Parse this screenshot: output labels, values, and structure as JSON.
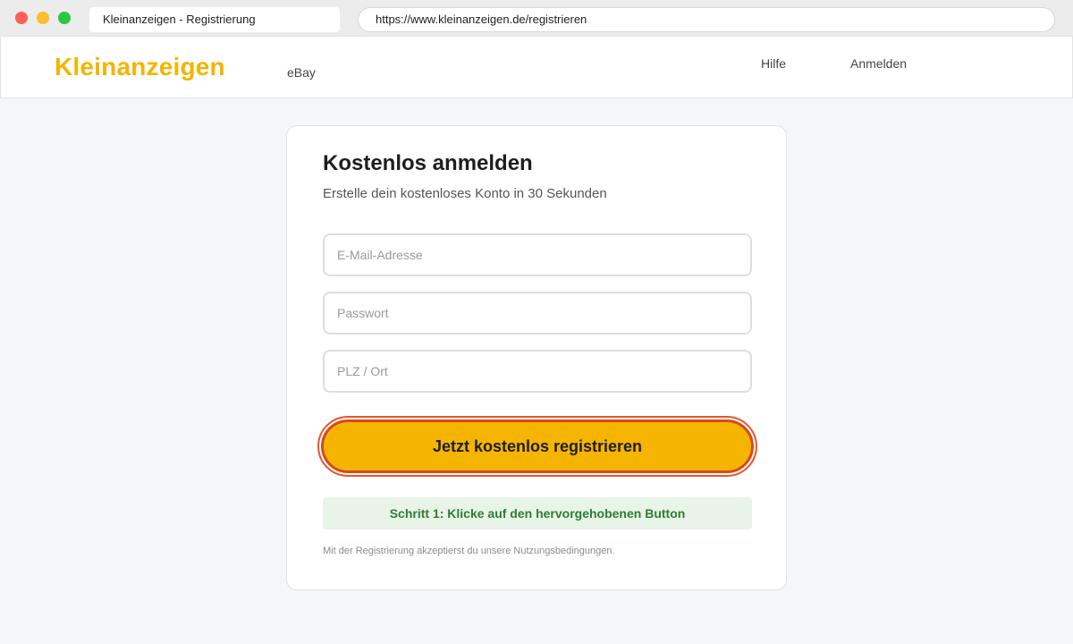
{
  "browser": {
    "tab_title": "Kleinanzeigen - Registrierung",
    "url": "https://www.kleinanzeigen.de/registrieren"
  },
  "header": {
    "logo": "Kleinanzeigen",
    "nav": {
      "ebay": "eBay",
      "hilfe": "Hilfe",
      "anmelden": "Anmelden"
    }
  },
  "form": {
    "title": "Kostenlos anmelden",
    "subtitle": "Erstelle dein kostenloses Konto in 30 Sekunden",
    "email": {
      "placeholder": "E-Mail-Adresse",
      "value": ""
    },
    "password": {
      "placeholder": "Passwort",
      "value": ""
    },
    "location": {
      "placeholder": "PLZ / Ort",
      "value": ""
    },
    "submit_label": "Jetzt kostenlos registrieren",
    "hint": "Schritt 1: Klicke auf den hervorgehobenen Button",
    "terms": "Mit der Registrierung akzeptierst du unsere Nutzungsbedingungen."
  },
  "colors": {
    "brand": "#f5b400",
    "highlight": "#e8552a",
    "hint_bg": "#e8f4e8",
    "hint_text": "#2e7d32"
  }
}
